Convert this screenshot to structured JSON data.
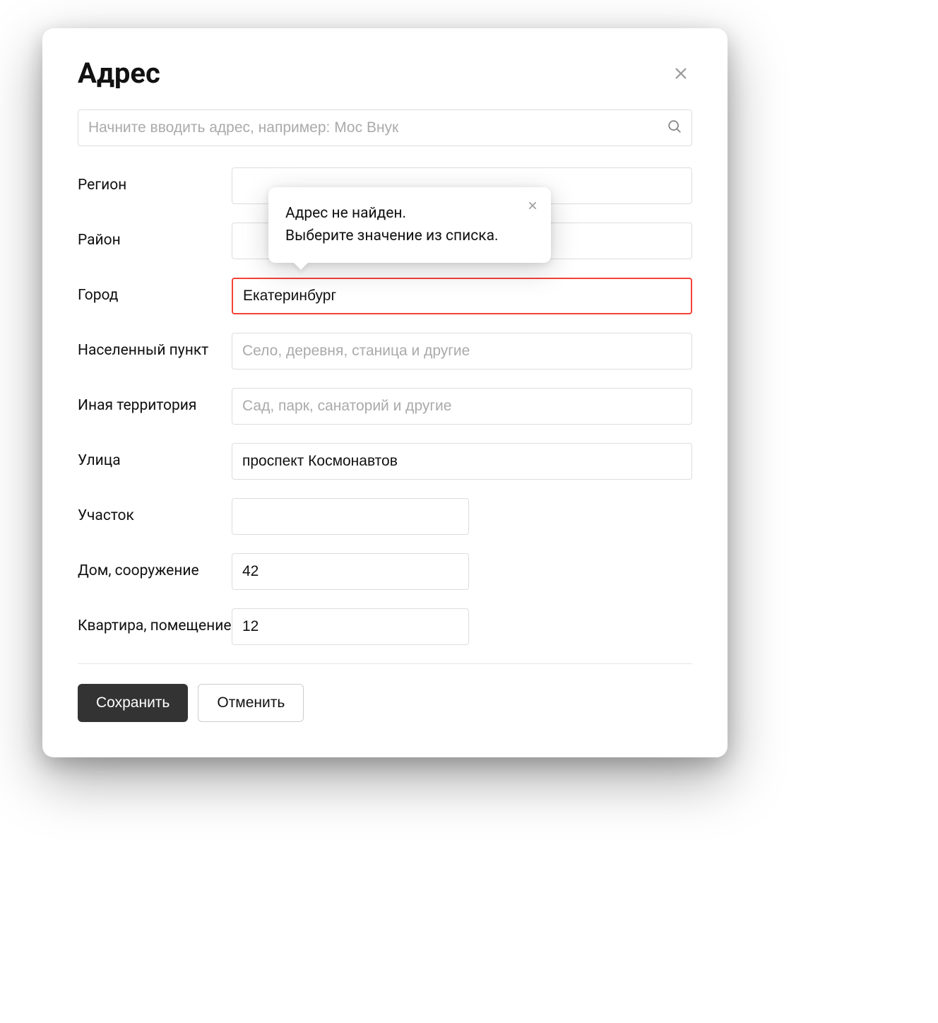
{
  "modal": {
    "title": "Адрес"
  },
  "search": {
    "placeholder": "Начните вводить адрес, например: Мос Внук",
    "value": ""
  },
  "tooltip": {
    "text": "Адрес не найден.\nВыберите значение из списка."
  },
  "fields": {
    "region": {
      "label": "Регион",
      "value": "",
      "placeholder": ""
    },
    "district": {
      "label": "Район",
      "value": "",
      "placeholder": ""
    },
    "city": {
      "label": "Город",
      "value": "Екатеринбург",
      "placeholder": ""
    },
    "settlement": {
      "label": "Населенный пункт",
      "value": "",
      "placeholder": "Село, деревня, станица и другие"
    },
    "territory": {
      "label": "Иная территория",
      "value": "",
      "placeholder": "Сад, парк, санаторий и другие"
    },
    "street": {
      "label": "Улица",
      "value": "проспект Космонавтов",
      "placeholder": ""
    },
    "plot": {
      "label": "Участок",
      "value": "",
      "placeholder": ""
    },
    "house": {
      "label": "Дом, сооружение",
      "value": "42",
      "placeholder": ""
    },
    "apartment": {
      "label": "Квартира, помещение",
      "value": "12",
      "placeholder": ""
    }
  },
  "buttons": {
    "save": "Сохранить",
    "cancel": "Отменить"
  }
}
